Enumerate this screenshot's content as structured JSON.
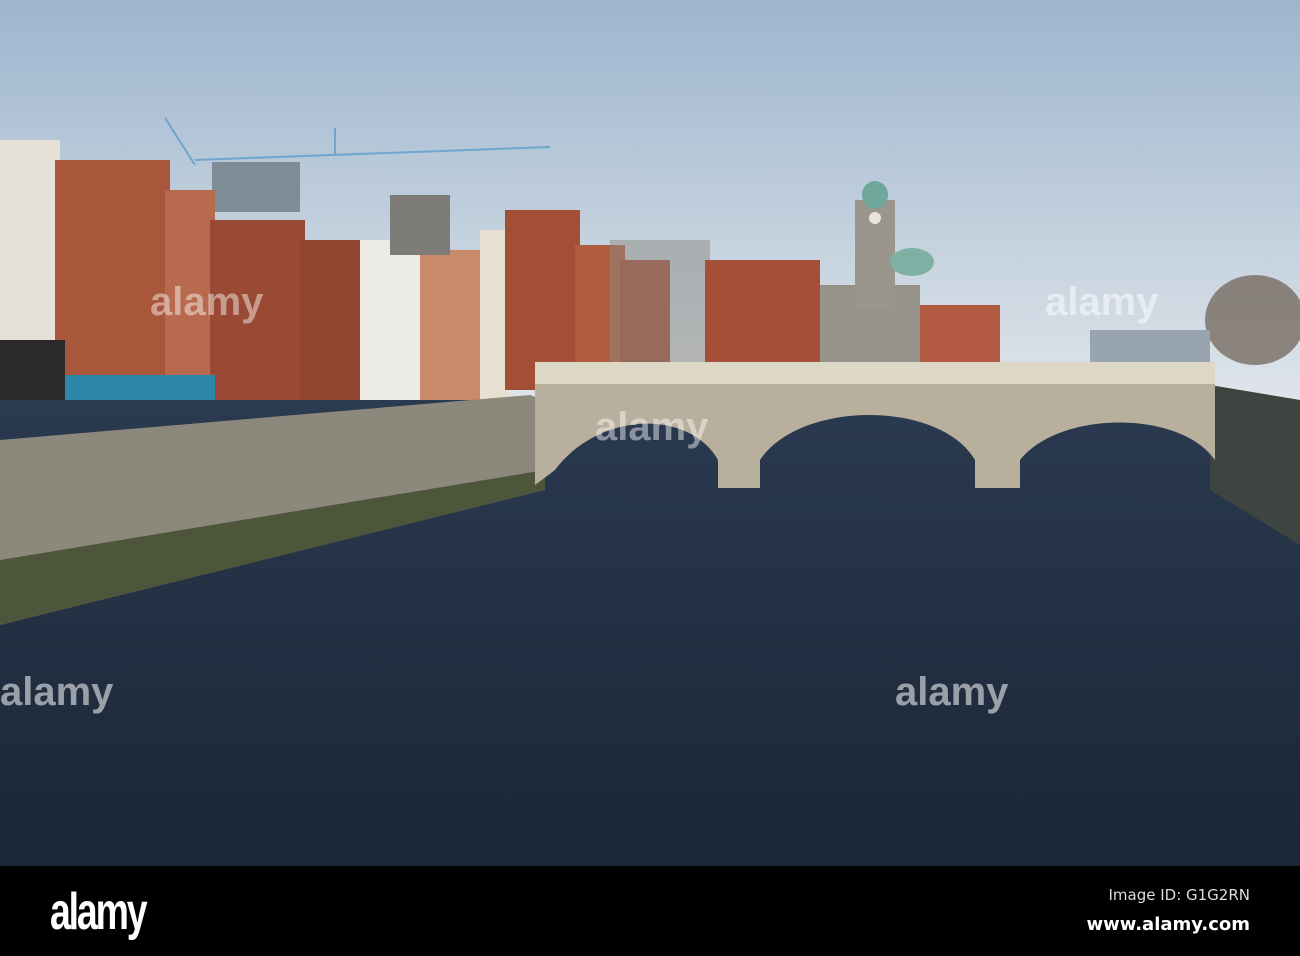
{
  "watermark": {
    "logo": "alamy"
  },
  "footer": {
    "logo": "alamy",
    "image_id": "Image ID: G1G2RN",
    "url": "www.alamy.com"
  },
  "colors": {
    "sky_top": "#9fb6cf",
    "sky_bottom": "#dfe5ea",
    "river": "#1f2e42",
    "brick": "#a8553a",
    "stone": "#bdb6a4"
  }
}
